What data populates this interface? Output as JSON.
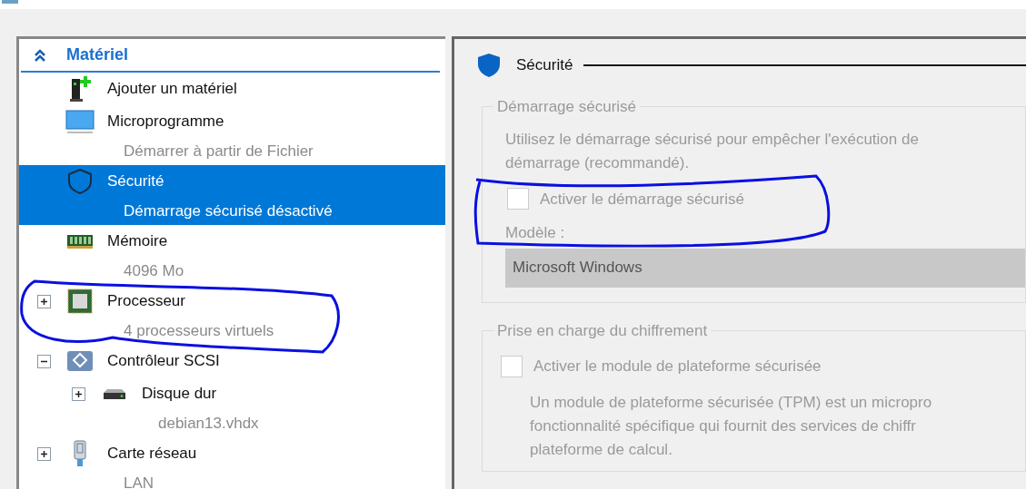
{
  "tree": {
    "header": {
      "label": "Matériel",
      "expanded": true
    },
    "items": [
      {
        "kind": "add",
        "title": "Ajouter un matériel",
        "selected": false
      },
      {
        "kind": "firmware",
        "title": "Microprogramme",
        "detail": "Démarrer à partir de Fichier",
        "selected": false
      },
      {
        "kind": "security",
        "title": "Sécurité",
        "detail": "Démarrage sécurisé désactivé",
        "selected": true
      },
      {
        "kind": "memory",
        "title": "Mémoire",
        "detail": "4096 Mo",
        "selected": false
      },
      {
        "kind": "processor",
        "title": "Processeur",
        "detail": "4 processeurs virtuels",
        "selected": false,
        "expanded": false
      },
      {
        "kind": "scsi",
        "title": "Contrôleur SCSI",
        "selected": false,
        "expanded": true,
        "children": [
          {
            "kind": "disk",
            "title": "Disque dur",
            "detail": "debian13.vhdx",
            "selected": false,
            "expanded": false
          }
        ]
      },
      {
        "kind": "network",
        "title": "Carte réseau",
        "detail": "LAN",
        "selected": false,
        "expanded": false
      }
    ]
  },
  "panel": {
    "title": "Sécurité",
    "groups": [
      {
        "kind": "secure-boot",
        "legend": "Démarrage sécurisé",
        "text": [
          "Utilisez le démarrage sécurisé pour empêcher l'exécution de",
          "démarrage (recommandé)."
        ],
        "checkbox": {
          "label": "Activer le démarrage sécurisé",
          "checked": false,
          "disabled": true
        },
        "template": {
          "label": "Modèle :",
          "value": "Microsoft Windows",
          "disabled": true
        }
      },
      {
        "kind": "encryption",
        "legend": "Prise en charge du chiffrement",
        "checkbox": {
          "label": "Activer le module de plateforme sécurisée",
          "checked": false,
          "disabled": true
        },
        "text": [
          "Un module de plateforme sécurisée (TPM) est un micropro",
          "fonctionnalité spécifique qui fournit des services de chiffr",
          "plateforme de calcul."
        ]
      }
    ]
  }
}
